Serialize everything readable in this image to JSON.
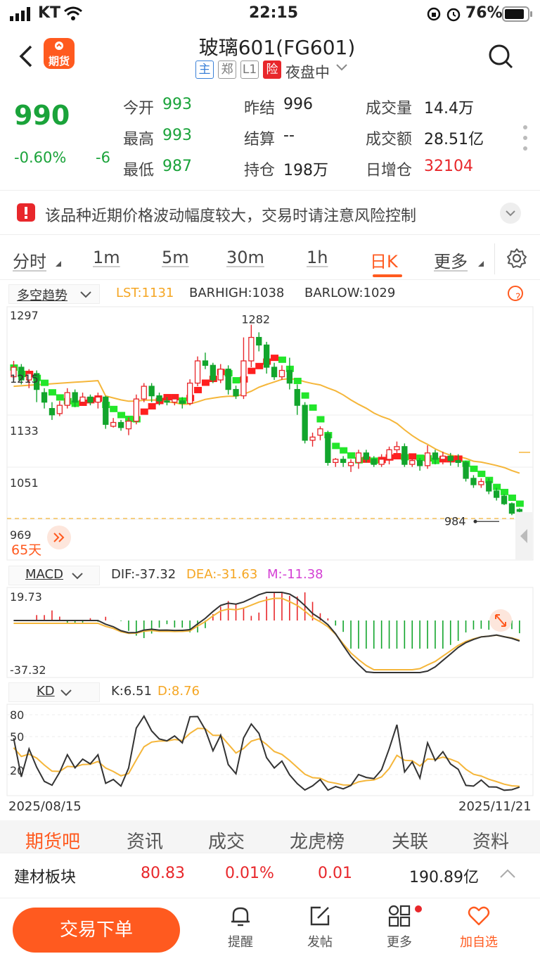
{
  "status_bar": {
    "carrier": "KT",
    "time": "22:15",
    "battery": "76%"
  },
  "header": {
    "logo_text": "期货",
    "title": "玻璃601(FG601)",
    "tags": [
      "主",
      "郑",
      "L1",
      "险"
    ],
    "session": "夜盘中"
  },
  "quote": {
    "price": "990",
    "change_pct": "-0.60%",
    "change": "-6",
    "open_label": "今开",
    "open": "993",
    "high_label": "最高",
    "high": "993",
    "low_label": "最低",
    "low": "987",
    "prev_close_label": "昨结",
    "prev_close": "996",
    "settle_label": "结算",
    "settle": "--",
    "oi_label": "持仓",
    "oi": "198万",
    "volume_label": "成交量",
    "volume": "14.4万",
    "turnover_label": "成交额",
    "turnover": "28.51亿",
    "oi_change_label": "日增仓",
    "oi_change": "32104"
  },
  "notice": {
    "text": "该品种近期价格波动幅度较大，交易时请注意风险控制"
  },
  "period_tabs": [
    "分时",
    "1m",
    "5m",
    "30m",
    "1h",
    "日K",
    "更多"
  ],
  "main_indicator": {
    "name": "多空趋势",
    "lst": "LST:1131",
    "barhigh": "BARHIGH:1038",
    "barlow": "BARLOW:1029",
    "help": "?"
  },
  "macd": {
    "name": "MACD",
    "dif": "DIF:-37.32",
    "dea": "DEA:-31.63",
    "m": "M:-11.38",
    "top_label": "19.73",
    "bottom_label": "-37.32"
  },
  "kd": {
    "name": "KD",
    "k": "K:6.51",
    "d": "D:8.76",
    "y_labels": [
      "80",
      "50",
      "20"
    ]
  },
  "date_range": {
    "start": "2025/08/15",
    "end": "2025/11/21"
  },
  "days_label": "65天",
  "bottom_tabs": [
    "期货吧",
    "资讯",
    "成交",
    "龙虎榜",
    "关联",
    "资料"
  ],
  "sector": {
    "name": "建材板块",
    "value": "80.83",
    "change": "0.01%",
    "change2": "0.01",
    "turnover": "190.89亿"
  },
  "bottom_bar": {
    "trade_button": "交易下单",
    "items": [
      "提醒",
      "发帖",
      "更多",
      "加自选"
    ]
  },
  "chart_data": {
    "type": "candlestick",
    "y_labels": [
      "1297",
      "1215",
      "1133",
      "1051",
      "969"
    ],
    "ylim": [
      969,
      1297
    ],
    "annotations": {
      "high_label": "1282",
      "low_label": "984"
    },
    "x_range": [
      "2025/08/15",
      "2025/11/21"
    ],
    "candles": [
      {
        "o": 1200,
        "c": 1215,
        "h": 1225,
        "l": 1195
      },
      {
        "o": 1215,
        "c": 1195,
        "h": 1220,
        "l": 1188
      },
      {
        "o": 1195,
        "c": 1205,
        "h": 1212,
        "l": 1182
      },
      {
        "o": 1205,
        "c": 1180,
        "h": 1210,
        "l": 1160
      },
      {
        "o": 1175,
        "c": 1160,
        "h": 1182,
        "l": 1150
      },
      {
        "o": 1150,
        "c": 1140,
        "h": 1160,
        "l": 1132
      },
      {
        "o": 1142,
        "c": 1155,
        "h": 1162,
        "l": 1138
      },
      {
        "o": 1155,
        "c": 1175,
        "h": 1182,
        "l": 1150
      },
      {
        "o": 1175,
        "c": 1160,
        "h": 1180,
        "l": 1152
      },
      {
        "o": 1160,
        "c": 1168,
        "h": 1175,
        "l": 1155
      },
      {
        "o": 1168,
        "c": 1160,
        "h": 1172,
        "l": 1155
      },
      {
        "o": 1160,
        "c": 1168,
        "h": 1175,
        "l": 1150
      },
      {
        "o": 1168,
        "c": 1125,
        "h": 1170,
        "l": 1118
      },
      {
        "o": 1122,
        "c": 1128,
        "h": 1135,
        "l": 1120
      },
      {
        "o": 1128,
        "c": 1120,
        "h": 1132,
        "l": 1115
      },
      {
        "o": 1118,
        "c": 1130,
        "h": 1136,
        "l": 1108
      },
      {
        "o": 1130,
        "c": 1165,
        "h": 1172,
        "l": 1125
      },
      {
        "o": 1165,
        "c": 1185,
        "h": 1190,
        "l": 1160
      },
      {
        "o": 1185,
        "c": 1170,
        "h": 1190,
        "l": 1160
      },
      {
        "o": 1170,
        "c": 1162,
        "h": 1175,
        "l": 1155
      },
      {
        "o": 1162,
        "c": 1160,
        "h": 1168,
        "l": 1155
      },
      {
        "o": 1160,
        "c": 1165,
        "h": 1172,
        "l": 1155
      },
      {
        "o": 1162,
        "c": 1158,
        "h": 1168,
        "l": 1150
      },
      {
        "o": 1158,
        "c": 1190,
        "h": 1196,
        "l": 1155
      },
      {
        "o": 1190,
        "c": 1225,
        "h": 1232,
        "l": 1185
      },
      {
        "o": 1225,
        "c": 1218,
        "h": 1238,
        "l": 1212
      },
      {
        "o": 1218,
        "c": 1195,
        "h": 1222,
        "l": 1190
      },
      {
        "o": 1195,
        "c": 1212,
        "h": 1220,
        "l": 1190
      },
      {
        "o": 1212,
        "c": 1180,
        "h": 1218,
        "l": 1172
      },
      {
        "o": 1180,
        "c": 1170,
        "h": 1186,
        "l": 1165
      },
      {
        "o": 1170,
        "c": 1225,
        "h": 1262,
        "l": 1165
      },
      {
        "o": 1225,
        "c": 1262,
        "h": 1282,
        "l": 1215
      },
      {
        "o": 1262,
        "c": 1250,
        "h": 1270,
        "l": 1240
      },
      {
        "o": 1250,
        "c": 1215,
        "h": 1255,
        "l": 1205
      },
      {
        "o": 1215,
        "c": 1200,
        "h": 1222,
        "l": 1195
      },
      {
        "o": 1200,
        "c": 1210,
        "h": 1218,
        "l": 1195
      },
      {
        "o": 1210,
        "c": 1190,
        "h": 1230,
        "l": 1180
      },
      {
        "o": 1180,
        "c": 1155,
        "h": 1188,
        "l": 1140
      },
      {
        "o": 1155,
        "c": 1100,
        "h": 1160,
        "l": 1095
      },
      {
        "o": 1100,
        "c": 1105,
        "h": 1112,
        "l": 1090
      },
      {
        "o": 1108,
        "c": 1118,
        "h": 1122,
        "l": 1100
      },
      {
        "o": 1110,
        "c": 1065,
        "h": 1115,
        "l": 1060
      },
      {
        "o": 1065,
        "c": 1070,
        "h": 1072,
        "l": 1058
      },
      {
        "o": 1070,
        "c": 1065,
        "h": 1075,
        "l": 1058
      },
      {
        "o": 1060,
        "c": 1065,
        "h": 1070,
        "l": 1050
      },
      {
        "o": 1065,
        "c": 1080,
        "h": 1085,
        "l": 1055
      },
      {
        "o": 1080,
        "c": 1070,
        "h": 1085,
        "l": 1065
      },
      {
        "o": 1070,
        "c": 1062,
        "h": 1075,
        "l": 1058
      },
      {
        "o": 1062,
        "c": 1070,
        "h": 1078,
        "l": 1058
      },
      {
        "o": 1070,
        "c": 1085,
        "h": 1090,
        "l": 1062
      },
      {
        "o": 1085,
        "c": 1090,
        "h": 1098,
        "l": 1080
      },
      {
        "o": 1090,
        "c": 1062,
        "h": 1095,
        "l": 1058
      },
      {
        "o": 1062,
        "c": 1068,
        "h": 1072,
        "l": 1058
      },
      {
        "o": 1068,
        "c": 1060,
        "h": 1072,
        "l": 1052
      },
      {
        "o": 1060,
        "c": 1080,
        "h": 1092,
        "l": 1055
      },
      {
        "o": 1080,
        "c": 1070,
        "h": 1085,
        "l": 1062
      },
      {
        "o": 1070,
        "c": 1075,
        "h": 1082,
        "l": 1062
      },
      {
        "o": 1075,
        "c": 1068,
        "h": 1080,
        "l": 1060
      },
      {
        "o": 1068,
        "c": 1065,
        "h": 1078,
        "l": 1058
      },
      {
        "o": 1065,
        "c": 1040,
        "h": 1068,
        "l": 1035
      },
      {
        "o": 1040,
        "c": 1030,
        "h": 1045,
        "l": 1025
      },
      {
        "o": 1030,
        "c": 1035,
        "h": 1040,
        "l": 1025
      },
      {
        "o": 1035,
        "c": 1020,
        "h": 1040,
        "l": 1015
      },
      {
        "o": 1020,
        "c": 1010,
        "h": 1025,
        "l": 1005
      },
      {
        "o": 1012,
        "c": 1000,
        "h": 1015,
        "l": 998
      },
      {
        "o": 1000,
        "c": 985,
        "h": 1002,
        "l": 982
      },
      {
        "o": 991,
        "c": 988,
        "h": 993,
        "l": 984
      }
    ]
  }
}
